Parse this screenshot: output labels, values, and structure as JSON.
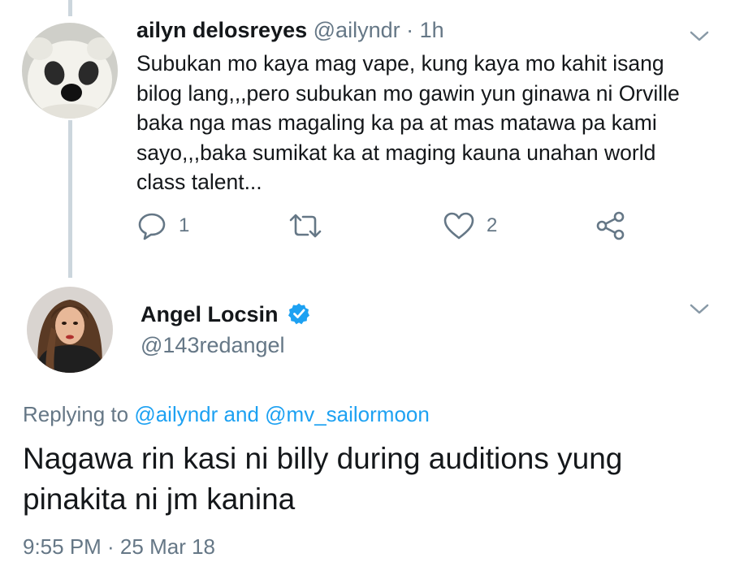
{
  "reply_tweet": {
    "author_name": "ailyn delosreyes",
    "author_handle": "@ailyndr",
    "separator": "·",
    "time_ago": "1h",
    "text_lines": [
      "Subukan mo kaya mag vape, kung kaya mo kahit isang",
      "bilog lang,,,pero subukan mo gawin yun ginawa ni Orville",
      "baka nga mas magaling ka pa at mas matawa pa kami",
      "sayo,,,baka sumikat ka at maging kauna unahan world",
      "class talent..."
    ],
    "actions": {
      "reply_count": "1",
      "retweet_count": "",
      "like_count": "2"
    }
  },
  "main_tweet": {
    "author_name": "Angel Locsin",
    "author_handle": "@143redangel",
    "verified": true,
    "replying_prefix": "Replying to",
    "replying_user1": "@ailyndr",
    "replying_and": "and",
    "replying_user2": "@mv_sailormoon",
    "text_lines": [
      "Nagawa rin kasi ni billy during  auditions yung",
      "pinakita ni jm kanina"
    ],
    "timestamp": "9:55 PM · 25 Mar 18"
  },
  "icons": {
    "reply": "reply-icon",
    "retweet": "retweet-icon",
    "like": "heart-icon",
    "share": "share-icon",
    "menu": "chevron-down-icon",
    "verified": "verified-badge-icon"
  },
  "colors": {
    "text": "#14171a",
    "muted": "#657786",
    "link": "#1da1f2",
    "verified": "#1da1f2",
    "thread_line": "#ccd6dd"
  }
}
